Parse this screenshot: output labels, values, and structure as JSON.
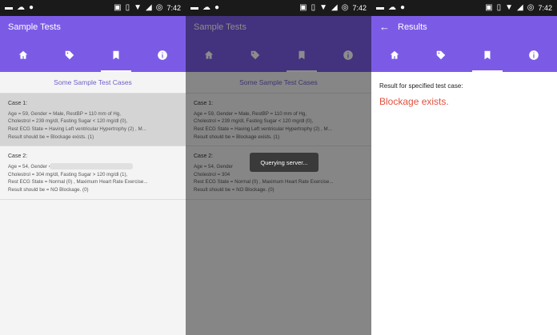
{
  "status": {
    "time": "7:42"
  },
  "screens": [
    {
      "title": "Sample Tests",
      "section_title": "Some Sample Test Cases",
      "cases": [
        {
          "title": "Case 1:",
          "lines": [
            "Age = 59, Gender = Male, RestBP = 110 mm of Hg,",
            "Cholestrol = 239 mg/dl, Fasting Sugar < 120 mg/dl (0),",
            "Rest ECG State = Having Left ventricular Hypertrophy (2) , M...",
            "Result should be = Blockage exists. (1)"
          ]
        },
        {
          "title": "Case 2:",
          "lines": [
            "Age = 54, Gender = Female, RestBP = 135 mm of Hg,",
            "Cholestrol = 304 mg/dl, Fasting Sugar > 120 mg/dl (1),",
            "Rest ECG State = Normal (0) , Maximum Heart Rate Exercise...",
            "Result should be = NO Blockage. (0)"
          ]
        }
      ]
    },
    {
      "title": "Sample Tests",
      "section_title": "Some Sample Test Cases",
      "toast": "Querying server...",
      "cases": [
        {
          "title": "Case 1:",
          "lines": [
            "Age = 59, Gender = Male, RestBP = 110 mm of Hg,",
            "Cholestrol = 239 mg/dl, Fasting Sugar < 120 mg/dl (0),",
            "Rest ECG State = Having Left ventricular Hypertrophy (2) , M...",
            "Result should be = Blockage exists. (1)"
          ]
        },
        {
          "title": "Case 2:",
          "lines": [
            "Age = 54, Gender",
            "Cholestrol = 304",
            "Rest ECG State = Normal (0) , Maximum Heart Rate Exercise...",
            "Result should be = NO Blockage. (0)"
          ]
        }
      ]
    },
    {
      "title": "Results",
      "result_label": "Result for specified test case:",
      "result_value": "Blockage exists."
    }
  ],
  "colors": {
    "primary": "#7b5be6",
    "accent_text": "#6f62c9",
    "result": "#e0513f"
  },
  "icons": [
    "home-icon",
    "tag-icon",
    "bookmark-icon",
    "info-icon"
  ]
}
